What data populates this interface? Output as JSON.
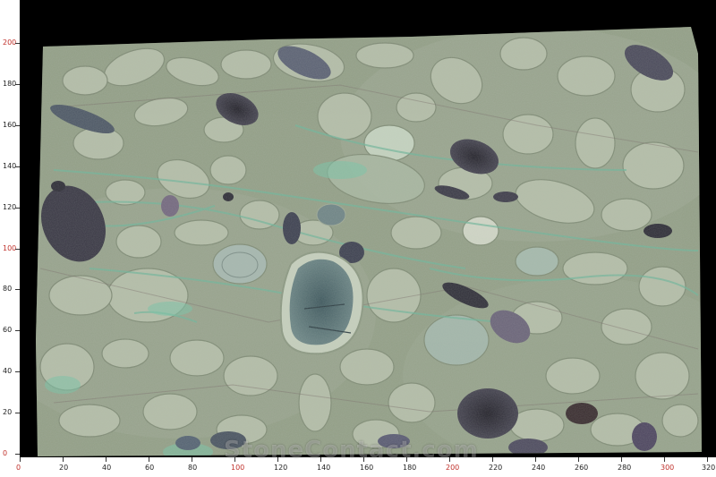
{
  "image": {
    "subject": "green marble slab",
    "colors": {
      "background": "#000000",
      "slab_base": "#8f9c84",
      "stone_light": "#b9c2ae",
      "stone_mid": "#9aa58e",
      "vein_green": "#6fb59a",
      "dark_inclusion": "#2c2a33",
      "purple_inclusion": "#5e5870",
      "blue_inclusion": "#4f6b70",
      "ruler_black": "#222222",
      "ruler_red": "#c0312b"
    }
  },
  "ruler_left": {
    "labels": [
      "200",
      "180",
      "160",
      "140",
      "120",
      "100",
      "80",
      "60",
      "40",
      "20",
      "0"
    ],
    "red_labels": [
      "200",
      "100",
      "0"
    ]
  },
  "ruler_bottom": {
    "labels": [
      "0",
      "20",
      "40",
      "60",
      "80",
      "100",
      "120",
      "140",
      "160",
      "180",
      "200",
      "220",
      "240",
      "260",
      "280",
      "300",
      "320"
    ],
    "red_labels": [
      "0",
      "100",
      "200",
      "300"
    ]
  },
  "watermark": {
    "text": "StoneContact.com"
  }
}
